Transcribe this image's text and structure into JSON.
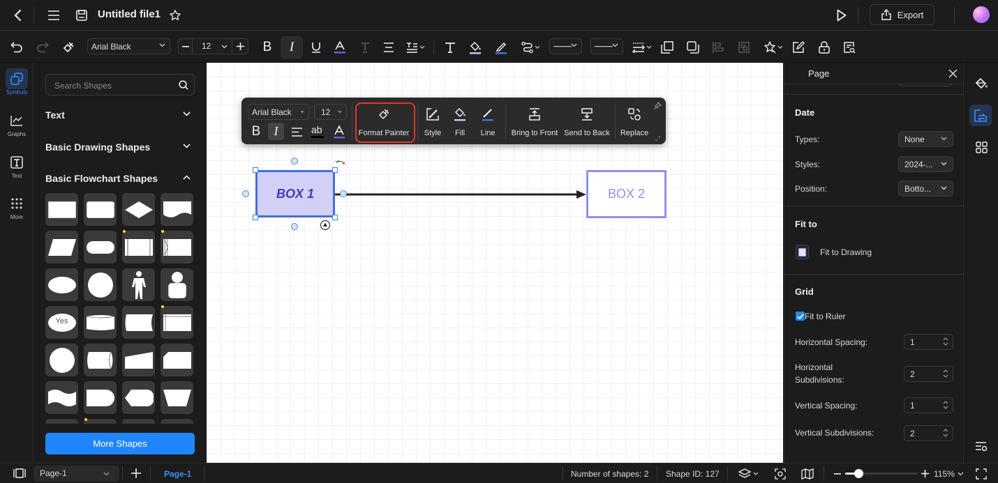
{
  "app": {
    "file_title": "Untitled file1",
    "export_label": "Export"
  },
  "toolbar": {
    "font_family": "Arial Black",
    "font_size": "12",
    "line_style_1": "solid",
    "line_style_2": "solid"
  },
  "left_rail": {
    "items": [
      {
        "label": "Symbols",
        "icon": "symbols-icon",
        "active": true
      },
      {
        "label": "Graphs",
        "icon": "graph-icon",
        "active": false
      },
      {
        "label": "Text",
        "icon": "text-box-icon",
        "active": false
      },
      {
        "label": "More",
        "icon": "grid-dots-icon",
        "active": false
      }
    ]
  },
  "library": {
    "search_placeholder": "Search Shapes",
    "sections": [
      {
        "label": "Text",
        "expanded": false
      },
      {
        "label": "Basic Drawing Shapes",
        "expanded": false
      },
      {
        "label": "Basic Flowchart Shapes",
        "expanded": true
      }
    ],
    "shapes": [
      "Process",
      "Alternate Process",
      "Decision",
      "Document",
      "Data",
      "Terminator",
      "Predefined Process",
      "Stored Data",
      "Ellipse",
      "Circle",
      "Actor",
      "User",
      "Yes",
      "Database",
      "Tape",
      "Internal Storage",
      "Connector",
      "Direct Data",
      "Manual Input",
      "Card",
      "Punched Tape",
      "Delay",
      "Display",
      "Manual Operation"
    ],
    "yes_shape_text": "Yes",
    "more_shapes_label": "More Shapes"
  },
  "floating_toolbar": {
    "font_family": "Arial Black",
    "font_size": "12",
    "buttons": [
      {
        "label": "Format Painter",
        "highlighted": true
      },
      {
        "label": "Style"
      },
      {
        "label": "Fill"
      },
      {
        "label": "Line"
      },
      {
        "label": "Bring to Front"
      },
      {
        "label": "Send to Back"
      },
      {
        "label": "Replace"
      }
    ]
  },
  "canvas": {
    "box1_label": "BOX 1",
    "box2_label": "BOX 2",
    "colors": {
      "box1_fill": "#d3d0f8",
      "box1_border": "#3f6fe0",
      "box1_text": "#4a37b8",
      "box2_border": "#8b93ea"
    }
  },
  "right_panel": {
    "title": "Page",
    "date_section": "Date",
    "types_label": "Types:",
    "types_value": "None",
    "styles_label": "Styles:",
    "styles_value": "2024-...",
    "position_label": "Position:",
    "position_value": "Botto...",
    "fit_section": "Fit to",
    "fit_to_drawing_label": "Fit to Drawing",
    "grid_section": "Grid",
    "fit_to_ruler_label": "Fit to Ruler",
    "fit_to_ruler_checked": true,
    "h_spacing_label": "Horizontal Spacing:",
    "h_spacing_value": "1",
    "h_subdiv_label_1": "Horizontal",
    "h_subdiv_label_2": "Subdivisions:",
    "h_subdiv_value": "2",
    "v_spacing_label": "Vertical Spacing:",
    "v_spacing_value": "1",
    "v_subdiv_label": "Vertical Subdivisions:",
    "v_subdiv_value": "2"
  },
  "bottom_bar": {
    "page_select": "Page-1",
    "page_tab": "Page-1",
    "shape_count": "Number of shapes: 2",
    "shape_id": "Shape ID: 127",
    "zoom_level": "115%",
    "zoom_slider_fraction": 0.18
  },
  "accent_color": "#1f86ff"
}
